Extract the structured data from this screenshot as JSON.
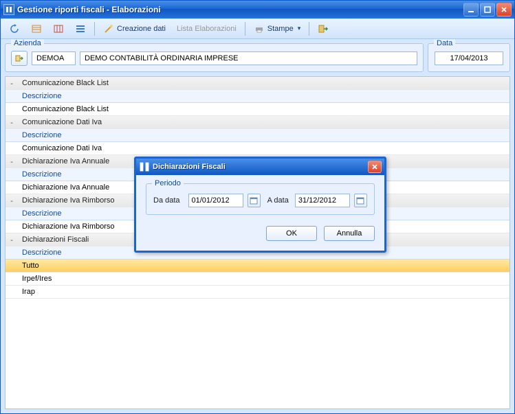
{
  "window": {
    "title": "Gestione riporti fiscali - Elaborazioni"
  },
  "toolbar": {
    "creazione_dati": "Creazione dati",
    "lista_elaborazioni": "Lista Elaborazioni",
    "stampe": "Stampe"
  },
  "panels": {
    "azienda_label": "Azienda",
    "azienda_code": "DEMOA",
    "azienda_desc": "DEMO  CONTABILITÀ  ORDINARIA  IMPRESE",
    "data_label": "Data",
    "data_value": "17/04/2013"
  },
  "grid": {
    "desc_header": "Descrizione",
    "groups": [
      {
        "name": "Comunicazione Black List",
        "rows": [
          "Comunicazione Black List"
        ]
      },
      {
        "name": "Comunicazione Dati Iva",
        "rows": [
          "Comunicazione Dati Iva"
        ]
      },
      {
        "name": "Dichiarazione Iva Annuale",
        "rows": [
          "Dichiarazione Iva Annuale"
        ]
      },
      {
        "name": "Dichiarazione Iva Rimborso",
        "rows": [
          "Dichiarazione Iva Rimborso"
        ]
      },
      {
        "name": "Dichiarazioni Fiscali",
        "rows": [
          "Tutto",
          "Irpef/Ires",
          "Irap"
        ]
      }
    ]
  },
  "dialog": {
    "title": "Dichiarazioni Fiscali",
    "periodo_label": "Periodo",
    "da_data_label": "Da data",
    "da_data_value": "01/01/2012",
    "a_data_label": "A data",
    "a_data_value": "31/12/2012",
    "ok": "OK",
    "annulla": "Annulla"
  }
}
